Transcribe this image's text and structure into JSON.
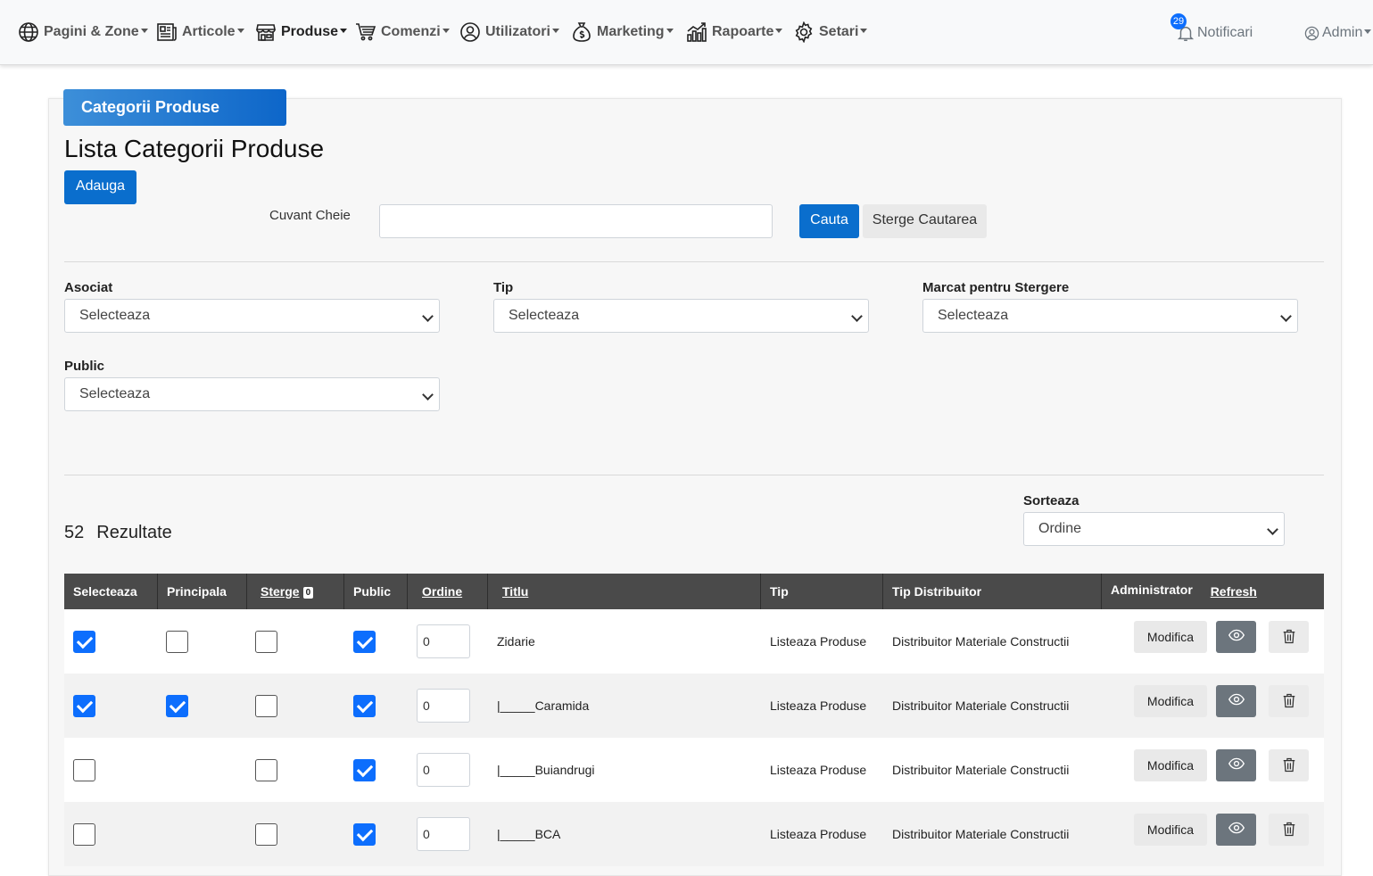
{
  "nav": {
    "items": [
      {
        "label": "Pagini & Zone",
        "icon": "globe-icon"
      },
      {
        "label": "Articole",
        "icon": "newspaper-icon"
      },
      {
        "label": "Produse",
        "icon": "shop-icon"
      },
      {
        "label": "Comenzi",
        "icon": "cart-icon"
      },
      {
        "label": "Utilizatori",
        "icon": "user-circle-icon"
      },
      {
        "label": "Marketing",
        "icon": "money-bag-icon"
      },
      {
        "label": "Rapoarte",
        "icon": "chart-icon"
      },
      {
        "label": "Setari",
        "icon": "gear-icon"
      }
    ],
    "notifications": {
      "label": "Notificari",
      "count": "29"
    },
    "user": {
      "label": "Admin"
    }
  },
  "panel": {
    "tab": "Categorii Produse",
    "title": "Lista Categorii Produse",
    "add_button": "Adauga"
  },
  "search": {
    "label": "Cuvant Cheie",
    "value": "",
    "search_button": "Cauta",
    "clear_button": "Sterge Cautarea"
  },
  "filters": {
    "asociat": {
      "label": "Asociat",
      "value": "Selecteaza"
    },
    "tip": {
      "label": "Tip",
      "value": "Selecteaza"
    },
    "marcat": {
      "label": "Marcat pentru Stergere",
      "value": "Selecteaza"
    },
    "public": {
      "label": "Public",
      "value": "Selecteaza"
    }
  },
  "sort": {
    "label": "Sorteaza",
    "value": "Ordine"
  },
  "results": {
    "count": "52",
    "label": "Rezultate"
  },
  "table": {
    "headers": {
      "selecteaza": "Selecteaza",
      "principala": "Principala",
      "sterge": "Sterge",
      "sterge_count": "0",
      "public": "Public",
      "ordine": "Ordine",
      "titlu": "Titlu",
      "tip": "Tip",
      "tip_distribuitor": "Tip Distribuitor",
      "administrator": "Administrator",
      "refresh": "Refresh"
    },
    "edit_label": "Modifica",
    "rows": [
      {
        "selected": true,
        "principala": false,
        "sterge": false,
        "public": true,
        "ordine": "0",
        "titlu": "Zidarie",
        "tip": "Listeaza Produse",
        "tip_distribuitor": "Distribuitor Materiale Constructii"
      },
      {
        "selected": true,
        "principala": true,
        "sterge": false,
        "public": true,
        "ordine": "0",
        "titlu": "|_____Caramida",
        "tip": "Listeaza Produse",
        "tip_distribuitor": "Distribuitor Materiale Constructii"
      },
      {
        "selected": false,
        "principala": null,
        "sterge": false,
        "public": true,
        "ordine": "0",
        "titlu": "|_____Buiandrugi",
        "tip": "Listeaza Produse",
        "tip_distribuitor": "Distribuitor Materiale Constructii"
      },
      {
        "selected": false,
        "principala": null,
        "sterge": false,
        "public": true,
        "ordine": "0",
        "titlu": "|_____BCA",
        "tip": "Listeaza Produse",
        "tip_distribuitor": "Distribuitor Materiale Constructii"
      }
    ]
  },
  "colors": {
    "primary": "#0a6ecd",
    "header_bg": "#4a4a4a",
    "checkbox": "#0d6efd"
  }
}
